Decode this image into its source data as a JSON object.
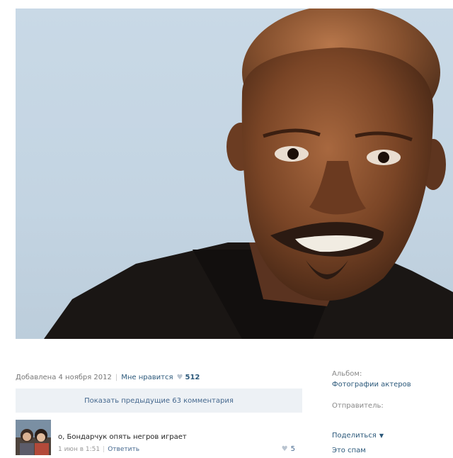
{
  "photo": {
    "subject_icon": "portrait-photo",
    "background_color": "#c6d6e4"
  },
  "meta": {
    "added": "Добавлена 4 ноября 2012",
    "separator": "|",
    "like_label": "Мне нравится",
    "like_icon": "heart-icon",
    "like_count": "512"
  },
  "comments_bar": {
    "show_previous": "Показать предыдущие 63 комментария"
  },
  "comment": {
    "text": "о, Бондарчук опять негров играет",
    "time": "1 июн в 1:51",
    "separator": "|",
    "reply": "Ответить",
    "like_icon": "heart-icon",
    "likes": "5"
  },
  "sidebar": {
    "album_label": "Альбом:",
    "album_name": "Фотографии актеров",
    "sender_label": "Отправитель:",
    "share": "Поделиться",
    "spam": "Это спам"
  },
  "colors": {
    "link": "#2b587a",
    "button_bg": "#edf1f5",
    "muted": "#777777"
  }
}
